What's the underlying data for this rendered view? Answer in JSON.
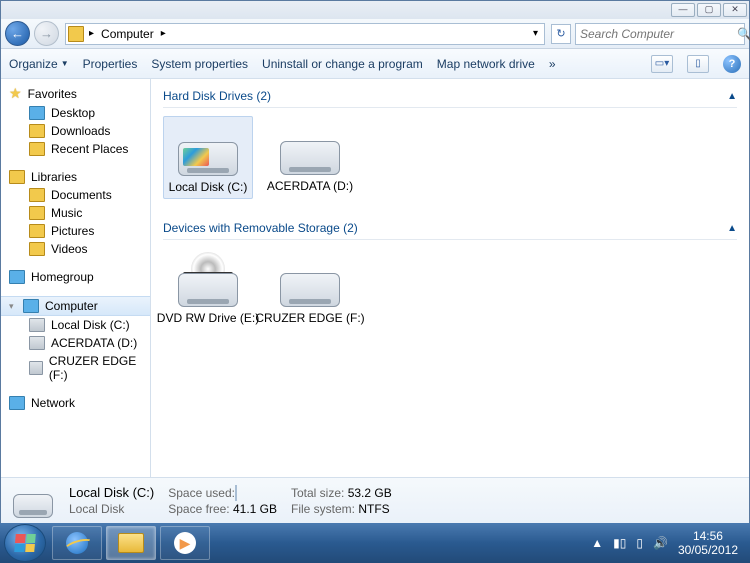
{
  "titlebar": {
    "min": "—",
    "max": "▢",
    "close": "✕"
  },
  "nav": {
    "crumb": "Computer",
    "dropdown": "▾",
    "refresh": "↻"
  },
  "search": {
    "placeholder": "Search Computer"
  },
  "toolbar": {
    "organize": "Organize",
    "properties": "Properties",
    "sysprops": "System properties",
    "uninstall": "Uninstall or change a program",
    "mapdrive": "Map network drive",
    "more": "»"
  },
  "sidebar": {
    "favorites": {
      "label": "Favorites",
      "items": [
        "Desktop",
        "Downloads",
        "Recent Places"
      ]
    },
    "libraries": {
      "label": "Libraries",
      "items": [
        "Documents",
        "Music",
        "Pictures",
        "Videos"
      ]
    },
    "homegroup": {
      "label": "Homegroup"
    },
    "computer": {
      "label": "Computer",
      "items": [
        "Local Disk (C:)",
        "ACERDATA (D:)",
        "CRUZER EDGE (F:)"
      ]
    },
    "network": {
      "label": "Network"
    }
  },
  "sections": {
    "hdd": {
      "title": "Hard Disk Drives (2)",
      "items": [
        "Local Disk (C:)",
        "ACERDATA (D:)"
      ]
    },
    "removable": {
      "title": "Devices with Removable Storage (2)",
      "items": [
        "DVD RW Drive (E:)",
        "CRUZER EDGE (F:)"
      ],
      "dvdlabel": "DVD"
    }
  },
  "details": {
    "title": "Local Disk (C:)",
    "subtitle": "Local Disk",
    "space_used_label": "Space used:",
    "space_free_label": "Space free:",
    "space_free": "41.1 GB",
    "total_label": "Total size:",
    "total": "53.2 GB",
    "fs_label": "File system:",
    "fs": "NTFS"
  },
  "clock": {
    "time": "14:56",
    "date": "30/05/2012"
  },
  "tray": {
    "up": "▲",
    "net": "▮▯",
    "action": "▯",
    "vol": "🔊"
  }
}
